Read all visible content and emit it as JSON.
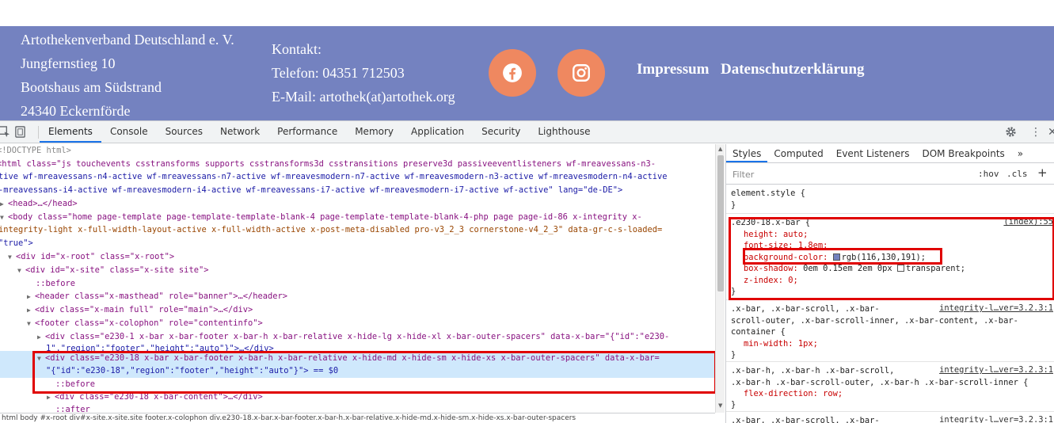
{
  "site": {
    "address": [
      "Artothekenverband Deutschland e. V.",
      "Jungfernstieg 10",
      "Bootshaus am Südstrand",
      "24340 Eckernförde"
    ],
    "contact": [
      "Kontakt:",
      "Telefon: 04351 712503",
      "E-Mail: artothek(at)artothek.org"
    ],
    "social": [
      {
        "icon": "facebook-icon"
      },
      {
        "icon": "instagram-icon"
      }
    ],
    "links": [
      "Impressum",
      "Datenschutzerklärung"
    ],
    "colors": {
      "band": "#7482c0",
      "social": "#ef8860"
    }
  },
  "devtools": {
    "tabs": [
      "Elements",
      "Console",
      "Sources",
      "Network",
      "Performance",
      "Memory",
      "Application",
      "Security",
      "Lighthouse"
    ],
    "active_tab": "Elements",
    "dom_lines": [
      "<!DOCTYPE html>",
      "<html class=\"js touchevents csstransforms supports csstransforms3d csstransitions preserve3d passiveeventlisteners wf-mreavessans-n3-",
      "tive wf-mreavessans-n4-active wf-mreavessans-n7-active wf-mreavesmodern-n7-active wf-mreavesmodern-n3-active wf-mreavesmodern-n4-active",
      "-mreavessans-i4-active wf-mreavesmodern-i4-active wf-mreavessans-i7-active wf-mreavesmodern-i7-active wf-active\" lang=\"de-DE\">",
      "<head>…</head>",
      "<body class=\"home page-template page-template-template-blank-4 page-template-template-blank-4-php page page-id-86 x-integrity x-",
      "integrity-light x-full-width-layout-active x-full-width-active x-post-meta-disabled pro-v3_2_3 cornerstone-v4_2_3\" data-gr-c-s-loaded=",
      "\"true\">",
      "<div id=\"x-root\" class=\"x-root\">",
      "<div id=\"x-site\" class=\"x-site site\">",
      "::before",
      "<header class=\"x-masthead\" role=\"banner\">…</header>",
      "<div class=\"x-main full\" role=\"main\">…</div>",
      "<footer class=\"x-colophon\" role=\"contentinfo\">",
      "<div class=\"e230-1 x-bar x-bar-footer x-bar-h x-bar-relative  x-hide-lg x-hide-xl x-bar-outer-spacers\" data-x-bar=\"{\"id\":\"e230-",
      "1\",\"region\":\"footer\",\"height\":\"auto\"}\">…</div>",
      "<div class=\"e230-18 x-bar x-bar-footer x-bar-h x-bar-relative  x-hide-md x-hide-sm x-hide-xs x-bar-outer-spacers\" data-x-bar=",
      "\"{\"id\":\"e230-18\",\"region\":\"footer\",\"height\":\"auto\"}\"> == $0",
      "::before",
      "<div class=\"e230-18 x-bar-content\">…</div>",
      "::after"
    ],
    "breadcrumb": "html  body  #x-root  div#x-site.x-site.site  footer.x-colophon  div.e230-18.x-bar.x-bar-footer.x-bar-h.x-bar-relative.x-hide-md.x-hide-sm.x-hide-xs.x-bar-outer-spacers",
    "styles_tabs": [
      "Styles",
      "Computed",
      "Event Listeners",
      "DOM Breakpoints",
      "»"
    ],
    "filter_placeholder": "Filter",
    "hov": ":hov",
    "cls": ".cls",
    "rules": {
      "element_style": [
        "element.style {",
        "}"
      ],
      "r1": {
        "selector": ".e230-18.x-bar {",
        "source": "(index):55",
        "props": [
          "height: auto;",
          "font-size: 1.8em;",
          "background-color: ",
          "box-shadow: ",
          "z-index: 0;"
        ],
        "bg_value": "rgb(116,130,191);",
        "shadow_value": "0em 0.15em 2em 0px ",
        "shadow_tail": "transparent;",
        "close": "}"
      },
      "r2": {
        "lines": [
          ".x-bar, .x-bar-scroll, .x-bar-",
          "scroll-outer, .x-bar-scroll-inner, .x-bar-content, .x-bar-",
          "container {"
        ],
        "source": "integrity-l…ver=3.2.3:1",
        "prop": "min-width: 1px;",
        "close": "}"
      },
      "r3": {
        "lines": [
          ".x-bar-h, .x-bar-h .x-bar-scroll,",
          ".x-bar-h .x-bar-scroll-outer, .x-bar-h .x-bar-scroll-inner {"
        ],
        "source": "integrity-l…ver=3.2.3:1",
        "prop": "flex-direction: row;",
        "close": "}"
      },
      "r4": {
        "line": ".x-bar, .x-bar-scroll, .x-bar-",
        "source": "integrity-l…ver=3.2.3:1"
      }
    }
  }
}
